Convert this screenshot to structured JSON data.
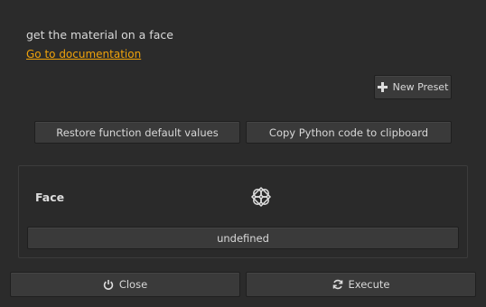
{
  "description": "get the material on a face",
  "doc_link": "Go to documentation",
  "buttons": {
    "new_preset": "New Preset",
    "restore_defaults": "Restore function default values",
    "copy_code": "Copy Python code to clipboard",
    "close": "Close",
    "execute": "Execute"
  },
  "parameter": {
    "label": "Face",
    "icon": "face-picker-icon",
    "value": "undefined"
  },
  "icons": {
    "new_preset": "plus-icon",
    "close": "power-icon",
    "execute": "refresh-icon"
  },
  "colors": {
    "background": "#2b2b2b",
    "link": "#f0a30a",
    "button": "#3a3a3a"
  }
}
